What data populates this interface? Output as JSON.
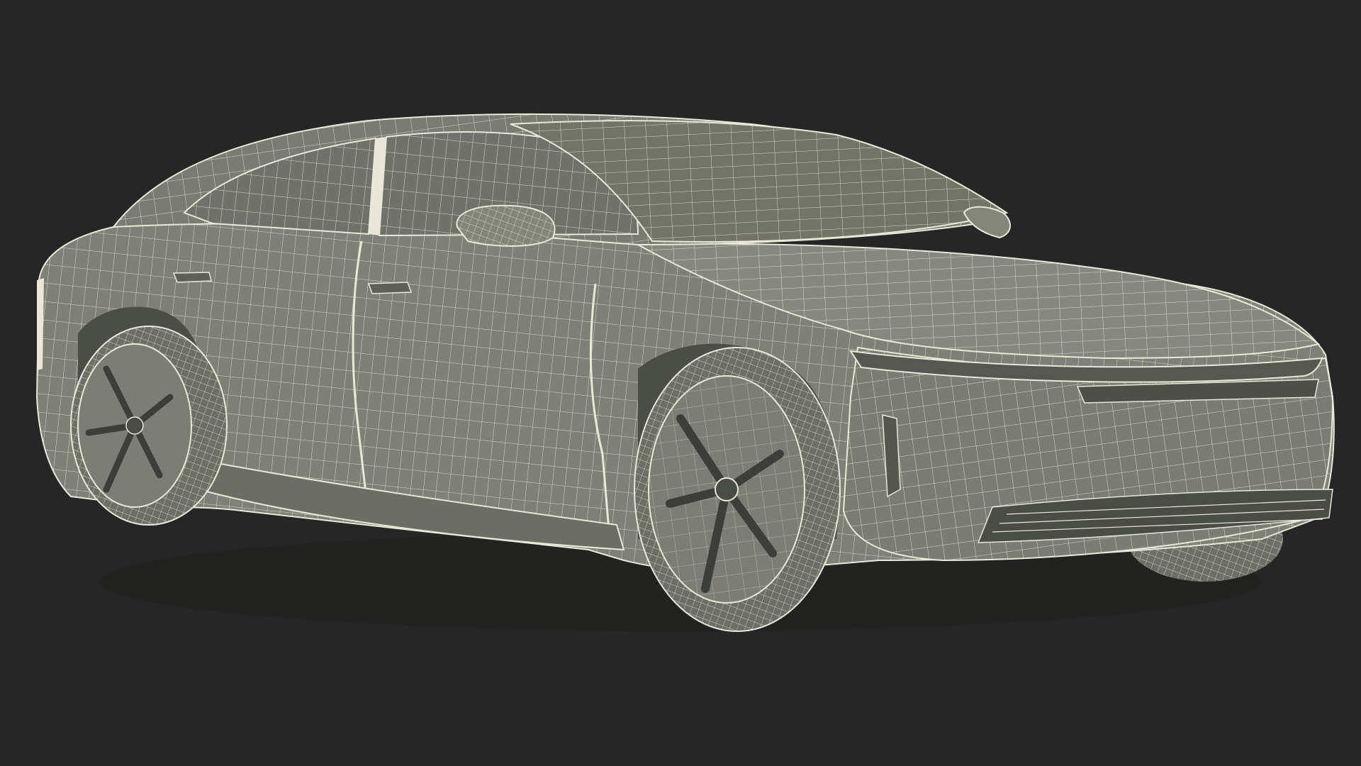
{
  "scene": {
    "subject": "sedan-wireframe-render",
    "colors": {
      "background": "#262626",
      "surface": "#7f8178",
      "surface_dark": "#62645c",
      "surface_light": "#91938a",
      "wire": "#e9e8d8",
      "tire": "#6d6f67",
      "shadow": "#3a3a37"
    }
  }
}
